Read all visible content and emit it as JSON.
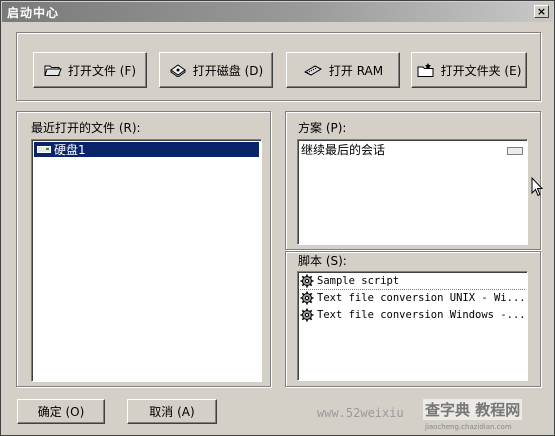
{
  "window": {
    "title": "启动中心",
    "close_glyph": "×"
  },
  "toolbar": {
    "buttons": [
      {
        "label": "打开文件 (F)",
        "icon": "open-folder-icon"
      },
      {
        "label": "打开磁盘 (D)",
        "icon": "disk-icon"
      },
      {
        "label": "打开 RAM",
        "icon": "ram-chip-icon"
      },
      {
        "label": "打开文件夹 (E)",
        "icon": "folder-star-icon"
      }
    ]
  },
  "recent": {
    "label": "最近打开的文件 (R):",
    "items": [
      {
        "text": "硬盘1",
        "icon": "drive-icon",
        "selected": true
      }
    ]
  },
  "scheme": {
    "label": "方案 (P):",
    "items": [
      {
        "text": "继续最后的会话",
        "icon": "drive-small-icon"
      }
    ]
  },
  "scripts": {
    "label": "脚本 (S):",
    "items": [
      {
        "text": "Sample script",
        "icon": "gear-icon"
      },
      {
        "text": "Text file conversion UNIX - Wi...",
        "icon": "gear-icon"
      },
      {
        "text": "Text file conversion Windows -...",
        "icon": "gear-icon"
      }
    ]
  },
  "footer": {
    "ok_label": "确定 (O)",
    "cancel_label": "取消 (A)"
  },
  "watermark": {
    "url": "www.52weixiu",
    "logo": "查字典 教程网",
    "sub": "jiaocheng.chazidian.com"
  }
}
